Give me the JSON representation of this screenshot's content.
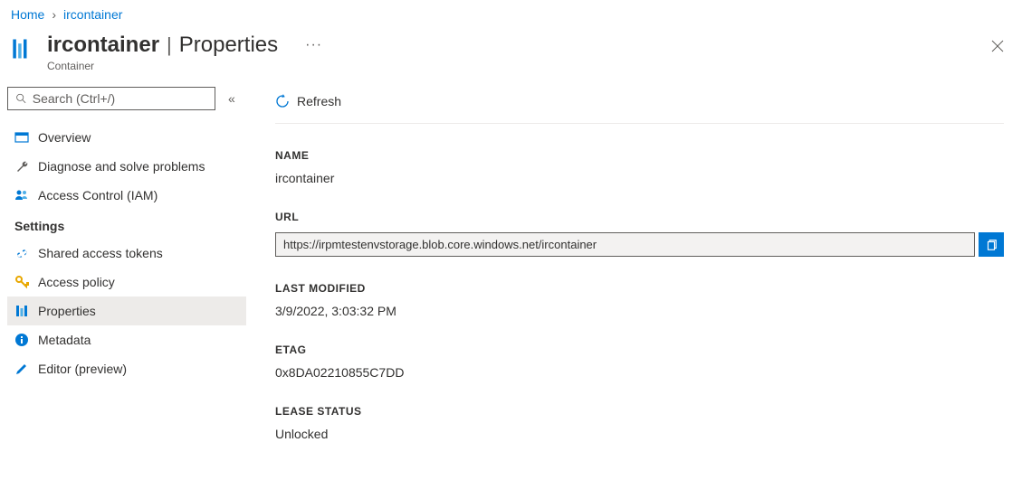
{
  "breadcrumb": {
    "home": "Home",
    "current": "ircontainer"
  },
  "header": {
    "title": "ircontainer",
    "section": "Properties",
    "subcaption": "Container"
  },
  "search": {
    "placeholder": "Search (Ctrl+/)"
  },
  "nav": {
    "overview": "Overview",
    "diagnose": "Diagnose and solve problems",
    "iam": "Access Control (IAM)",
    "section_settings": "Settings",
    "shared_tokens": "Shared access tokens",
    "access_policy": "Access policy",
    "properties": "Properties",
    "metadata": "Metadata",
    "editor": "Editor (preview)"
  },
  "toolbar": {
    "refresh": "Refresh"
  },
  "props": {
    "name_label": "NAME",
    "name_value": "ircontainer",
    "url_label": "URL",
    "url_value": "https://irpmtestenvstorage.blob.core.windows.net/ircontainer",
    "modified_label": "LAST MODIFIED",
    "modified_value": "3/9/2022, 3:03:32 PM",
    "etag_label": "ETAG",
    "etag_value": "0x8DA02210855C7DD",
    "lease_label": "LEASE STATUS",
    "lease_value": "Unlocked"
  }
}
